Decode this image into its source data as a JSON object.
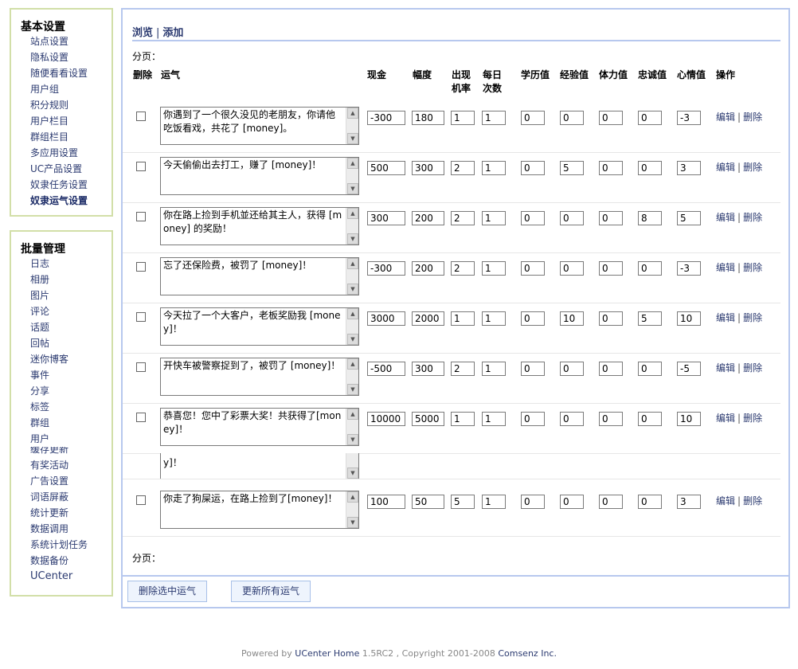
{
  "sidebar": {
    "basic": {
      "title": "基本设置",
      "items": [
        "站点设置",
        "隐私设置",
        "随便看看设置",
        "用户组",
        "积分规则",
        "用户栏目",
        "群组栏目",
        "多应用设置",
        "UC产品设置",
        "奴隶任务设置",
        "奴隶运气设置"
      ]
    },
    "batch": {
      "title": "批量管理",
      "items": [
        "日志",
        "相册",
        "图片",
        "评论",
        "话题",
        "回帖",
        "迷你博客",
        "事件",
        "分享",
        "标签",
        "群组",
        "用户",
        "缓存更新",
        "有奖活动",
        "广告设置",
        "词语屏蔽",
        "统计更新",
        "数据调用",
        "系统计划任务",
        "数据备份",
        "UCenter"
      ]
    }
  },
  "tabs": {
    "browse": "浏览",
    "add": "添加"
  },
  "pager_label": "分页：",
  "headers": {
    "delete": "删除",
    "luck": "运气",
    "cash": "现金",
    "range": "幅度",
    "prob_1": "出现",
    "prob_2": "机率",
    "daily_1": "每日",
    "daily_2": "次数",
    "education": "学历值",
    "experience": "经验值",
    "stamina": "体力值",
    "loyalty": "忠诚值",
    "mood": "心情值",
    "ops": "操作"
  },
  "ops": {
    "edit": "编辑",
    "delete": "删除"
  },
  "rows": [
    {
      "text": "你遇到了一个很久没见的老朋友，你请他吃饭看戏，共花了 [money]。",
      "cash": "-300",
      "range": "180",
      "prob": "1",
      "daily": "1",
      "education": "0",
      "experience": "0",
      "stamina": "0",
      "loyalty": "0",
      "mood": "-3"
    },
    {
      "text": "今天偷偷出去打工，赚了 [money]！",
      "cash": "500",
      "range": "300",
      "prob": "2",
      "daily": "1",
      "education": "0",
      "experience": "5",
      "stamina": "0",
      "loyalty": "0",
      "mood": "3"
    },
    {
      "text": "你在路上捡到手机並还给其主人，获得 [money] 的奖励！",
      "cash": "300",
      "range": "200",
      "prob": "2",
      "daily": "1",
      "education": "0",
      "experience": "0",
      "stamina": "0",
      "loyalty": "8",
      "mood": "5"
    },
    {
      "text": "忘了还保险费，被罚了 [money]！",
      "cash": "-300",
      "range": "200",
      "prob": "2",
      "daily": "1",
      "education": "0",
      "experience": "0",
      "stamina": "0",
      "loyalty": "0",
      "mood": "-3"
    },
    {
      "text": "今天拉了一个大客户，老板奖励我 [money]！",
      "cash": "3000",
      "range": "2000",
      "prob": "1",
      "daily": "1",
      "education": "0",
      "experience": "10",
      "stamina": "0",
      "loyalty": "5",
      "mood": "10"
    },
    {
      "text": "开快车被警察捉到了，被罚了 [money]！",
      "cash": "-500",
      "range": "300",
      "prob": "2",
      "daily": "1",
      "education": "0",
      "experience": "0",
      "stamina": "0",
      "loyalty": "0",
      "mood": "-5"
    },
    {
      "text": "恭喜您！您中了彩票大奖！共获得了[money]！",
      "cash": "10000",
      "range": "5000",
      "prob": "1",
      "daily": "1",
      "education": "0",
      "experience": "0",
      "stamina": "0",
      "loyalty": "0",
      "mood": "10"
    },
    {
      "text": "y]！",
      "cash": "",
      "range": "",
      "prob": "",
      "daily": "",
      "education": "",
      "experience": "",
      "stamina": "",
      "loyalty": "",
      "mood": ""
    },
    {
      "text": "你走了狗屎运，在路上捡到了[money]！",
      "cash": "100",
      "range": "50",
      "prob": "5",
      "daily": "1",
      "education": "0",
      "experience": "0",
      "stamina": "0",
      "loyalty": "0",
      "mood": "3"
    }
  ],
  "buttons": {
    "delete_selected": "删除选中运气",
    "update_all": "更新所有运气"
  },
  "footer": {
    "powered": "Powered by ",
    "product": "UCenter Home",
    "version": " 1.5RC2 , Copyright 2001-2008 ",
    "company": "Comsenz Inc."
  }
}
